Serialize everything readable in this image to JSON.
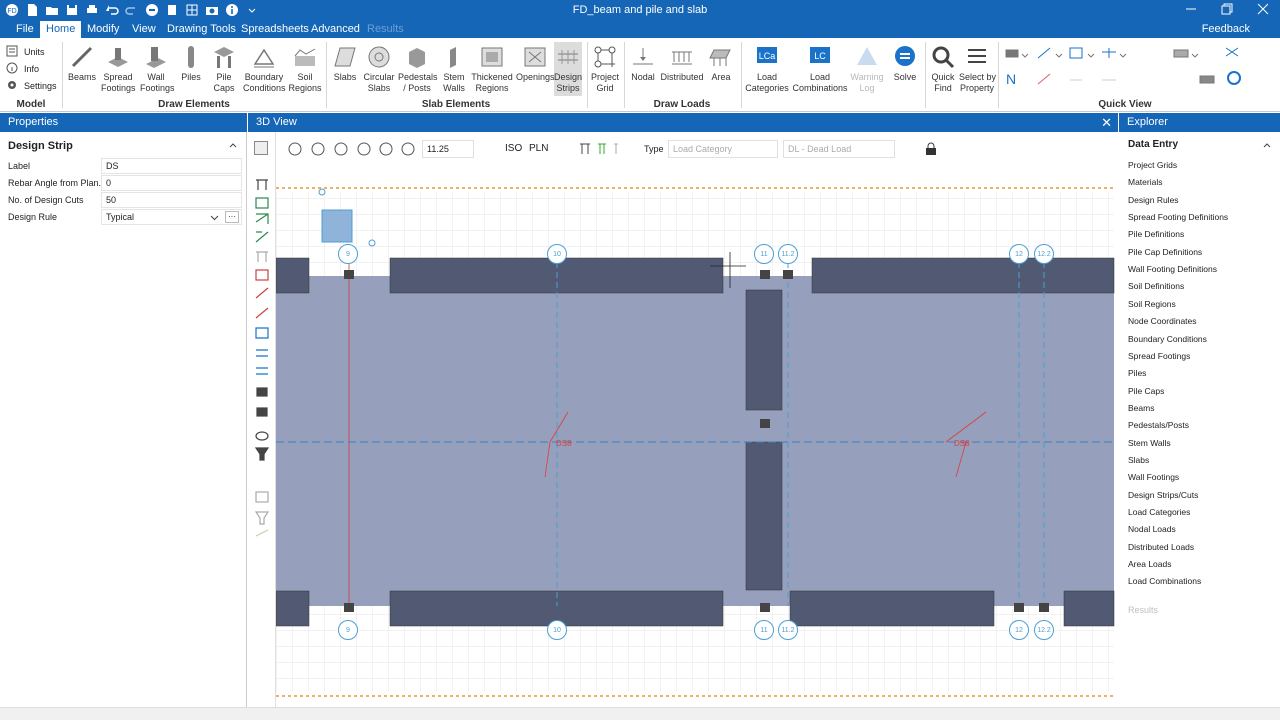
{
  "window": {
    "title": "FD_beam and pile and slab",
    "feedback": "Feedback"
  },
  "menu": [
    {
      "label": "File"
    },
    {
      "label": "Home"
    },
    {
      "label": "Modify"
    },
    {
      "label": "View"
    },
    {
      "label": "Drawing Tools"
    },
    {
      "label": "Spreadsheets"
    },
    {
      "label": "Advanced"
    },
    {
      "label": "Results"
    }
  ],
  "ribbon": {
    "model_items": [
      "Units",
      "Info",
      "Settings"
    ],
    "groups": [
      "Model",
      "Draw Elements",
      "Slab Elements",
      "Draw Loads",
      "Quick View"
    ],
    "draw_elements": [
      "Beams",
      "Spread\nFootings",
      "Wall\nFootings",
      "Piles",
      "Pile\nCaps",
      "Boundary\nConditions",
      "Soil\nRegions"
    ],
    "slab_elements": [
      "Slabs",
      "Circular\nSlabs",
      "Pedestals\n/ Posts",
      "Stem\nWalls",
      "Thickened\nRegions",
      "Openings",
      "Design\nStrips"
    ],
    "project_grid": "Project\nGrid",
    "draw_loads": [
      "Nodal",
      "Distributed",
      "Area"
    ],
    "load_buttons": [
      "Load\nCategories",
      "Load\nCombinations",
      "Warning\nLog",
      "Solve",
      "Quick\nFind",
      "Select by\nProperty"
    ]
  },
  "properties": {
    "header": "Properties",
    "section": "Design Strip",
    "rows": [
      {
        "label": "Label",
        "value": "DS"
      },
      {
        "label": "Rebar Angle from Plan...",
        "value": "0"
      },
      {
        "label": "No. of Design Cuts",
        "value": "50"
      },
      {
        "label": "Design Rule",
        "value": "Typical"
      }
    ]
  },
  "view": {
    "header": "3D View",
    "zoom": "11.25",
    "iso": "ISO",
    "pln": "PLN",
    "type_label": "Type",
    "load_category_placeholder": "Load Category",
    "load_case": "DL - Dead Load",
    "strip_label": "DS8",
    "columns_top": [
      "9",
      "10",
      "11",
      "11.2",
      "12",
      "12.2"
    ],
    "columns_bottom": [
      "9",
      "10",
      "11",
      "11.2",
      "12",
      "12.2"
    ]
  },
  "explorer": {
    "header": "Explorer",
    "section": "Data Entry",
    "items": [
      "Project Grids",
      "Materials",
      "Design Rules",
      "Spread Footing Definitions",
      "Pile Definitions",
      "Pile Cap Definitions",
      "Wall Footing Definitions",
      "Soil Definitions",
      "Soil Regions",
      "Node Coordinates",
      "Boundary Conditions",
      "Spread Footings",
      "Piles",
      "Pile Caps",
      "Beams",
      "Pedestals/Posts",
      "Stem Walls",
      "Slabs",
      "Wall Footings",
      "Design Strips/Cuts",
      "Load Categories",
      "Nodal Loads",
      "Distributed Loads",
      "Area Loads",
      "Load Combinations"
    ],
    "results": "Results"
  },
  "colors": {
    "accent": "#1566b7",
    "slab": "#969fbb",
    "beam": "#525a73",
    "grid_line": "#4b9fd5",
    "strip_red": "#e03c3c"
  }
}
